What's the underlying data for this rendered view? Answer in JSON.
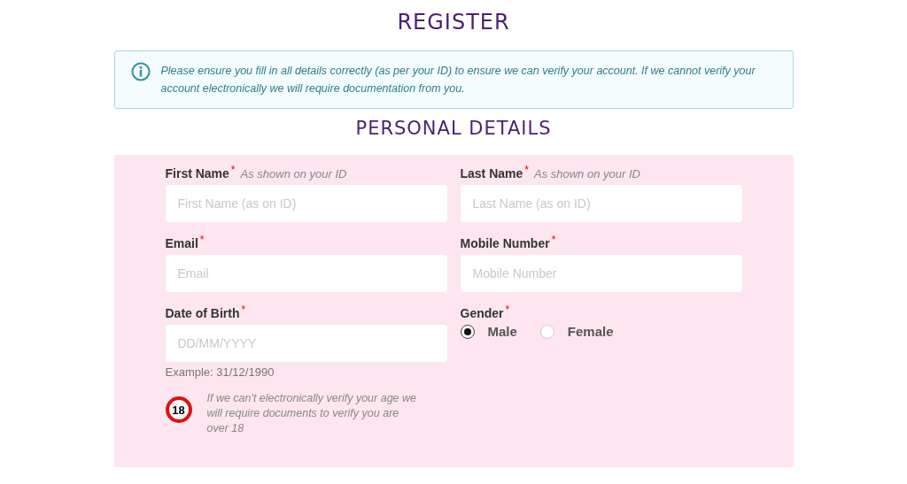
{
  "title": "REGISTER",
  "notice": {
    "text": "Please ensure you fill in all details correctly (as per your ID) to ensure we can verify your account. If we cannot verify your account electronically we will require documentation from you."
  },
  "section_title": "PERSONAL DETAILS",
  "fields": [
    {
      "kind": "text",
      "label": "First Name",
      "asterisk": "*",
      "hint": "As shown on your ID",
      "placeholder": "First Name (as on ID)"
    },
    {
      "kind": "text",
      "label": "Last Name",
      "asterisk": "*",
      "hint": "As shown on your ID",
      "placeholder": "Last Name (as on ID)"
    },
    {
      "kind": "text",
      "label": "Email",
      "asterisk": "*",
      "placeholder": "Email"
    },
    {
      "kind": "text",
      "label": "Mobile Number",
      "asterisk": "*",
      "placeholder": "Mobile Number"
    },
    {
      "kind": "text",
      "label": "Date of Birth",
      "asterisk": "*",
      "placeholder": "DD/MM/YYYY",
      "example": "Example: 31/12/1990"
    },
    {
      "kind": "radio",
      "label": "Gender",
      "asterisk": "*",
      "options": [
        {
          "label": "Male",
          "selected": true
        },
        {
          "label": "Female",
          "selected": false
        }
      ]
    }
  ],
  "age_notice": {
    "badge": "18",
    "text": "If we can't electronically verify your age we will require documents to verify you are over 18"
  }
}
